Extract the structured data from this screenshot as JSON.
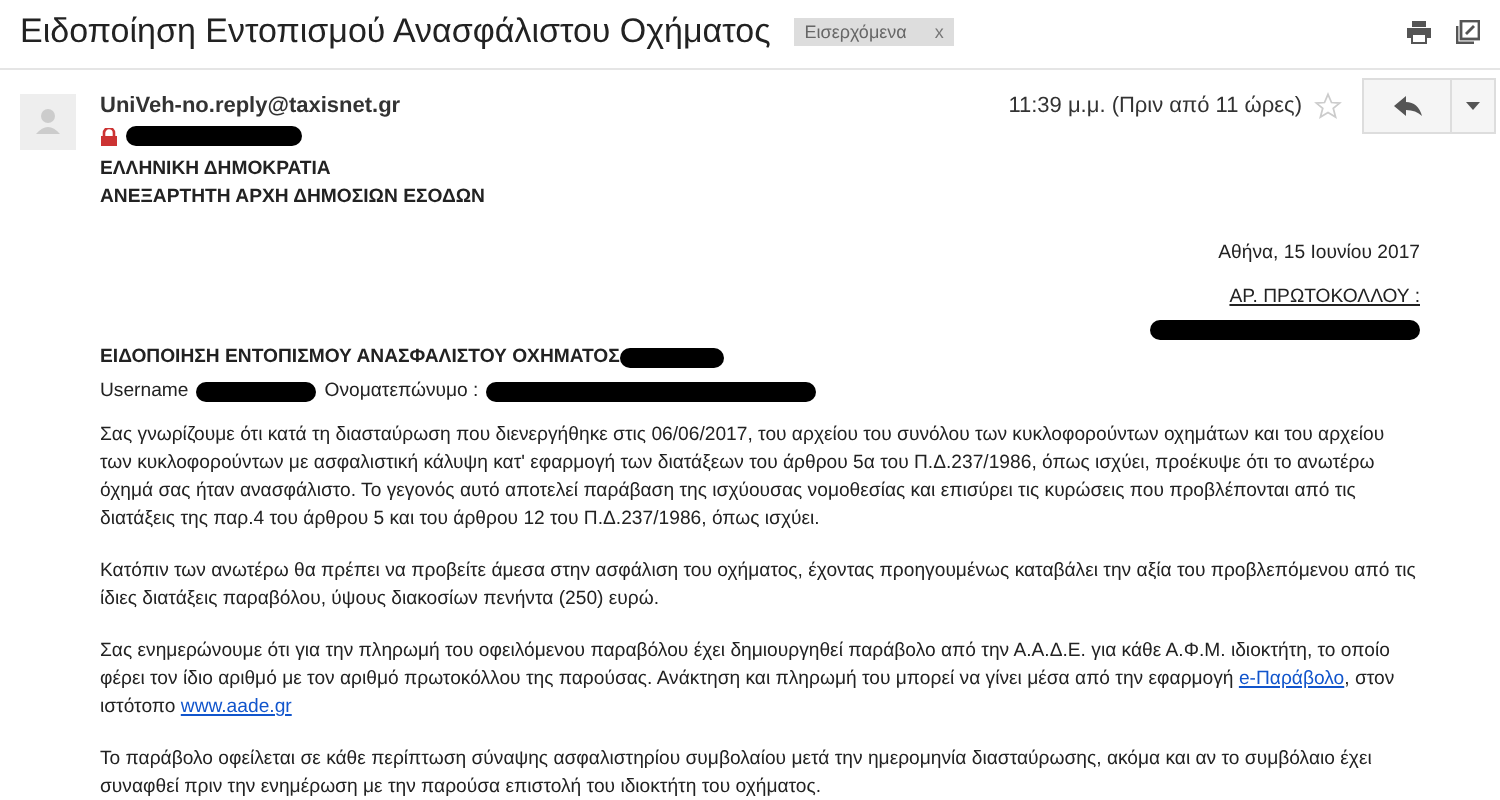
{
  "subject": "Ειδοποίηση Εντοπισμού Ανασφάλιστου Οχήματος",
  "label_chip": {
    "label": "Εισερχόμενα",
    "remove": "x"
  },
  "sender": "UniVeh-no.reply@taxisnet.gr",
  "time": "11:39 μ.μ. (Πριν από 11 ώρες)",
  "starred": false,
  "header_lines": [
    "ΕΛΛΗΝΙΚΗ ΔΗΜΟΚΡΑΤΙΑ",
    "ΑΝΕΞΑΡΤΗΤΗ ΑΡΧΗ ΔΗΜΟΣΙΩΝ ΕΣΟΔΩΝ"
  ],
  "date_line": "Αθήνα, 15 Ιουνίου 2017",
  "protocol_label": "ΑΡ. ΠΡΩΤΟΚΟΛΛΟΥ :",
  "notice_title": "ΕΙΔΟΠΟΙΗΣΗ ΕΝΤΟΠΙΣΜΟΥ ΑΝΑΣΦΑΛΙΣΤΟΥ ΟΧΗΜΑΤΟΣ",
  "username_label": "Username",
  "fullname_label": "Ονοματεπώνυμο :",
  "paragraphs": [
    [
      {
        "kind": "text",
        "text": "Σας γνωρίζουμε ότι κατά τη διασταύρωση που διενεργήθηκε στις 06/06/2017, του αρχείου του συνόλου των κυκλοφορούντων οχημάτων και του αρχείου των κυκλοφορούντων με ασφαλιστική κάλυψη κατ' εφαρμογή των διατάξεων του άρθρου 5α του Π.Δ.237/1986, όπως ισχύει, προέκυψε ότι το ανωτέρω όχημά σας ήταν ανασφάλιστο. Το γεγονός αυτό αποτελεί παράβαση της ισχύουσας νομοθεσίας και επισύρει τις κυρώσεις που προβλέπονται από τις διατάξεις της παρ.4 του άρθρου 5 και του άρθρου 12 του Π.Δ.237/1986, όπως ισχύει."
      }
    ],
    [
      {
        "kind": "text",
        "text": "Κατόπιν των ανωτέρω θα πρέπει να προβείτε άμεσα στην ασφάλιση του οχήματος, έχοντας προηγουμένως καταβάλει την αξία του προβλεπόμενου από τις ίδιες διατάξεις παραβόλου, ύψους διακοσίων πενήντα (250) ευρώ."
      }
    ],
    [
      {
        "kind": "text",
        "text": "Σας ενημερώνουμε ότι για την πληρωμή του οφειλόμενου παραβόλου έχει δημιουργηθεί παράβολο από την Α.Α.Δ.Ε. για κάθε Α.Φ.Μ. ιδιοκτήτη, το οποίο φέρει τον ίδιο αριθμό με τον αριθμό πρωτοκόλλου της παρούσας. Ανάκτηση και πληρωμή του μπορεί να γίνει μέσα από την εφαρμογή "
      },
      {
        "kind": "link",
        "text": "e-Παράβολο"
      },
      {
        "kind": "text",
        "text": ", στον ιστότοπο "
      },
      {
        "kind": "link",
        "text": "www.aade.gr"
      }
    ],
    [
      {
        "kind": "text",
        "text": "Το παράβολο οφείλεται σε κάθε περίπτωση σύναψης ασφαλιστηρίου συμβολαίου μετά την ημερομηνία διασταύρωσης, ακόμα και αν το συμβόλαιο έχει συναφθεί πριν την ενημέρωση με την παρούσα επιστολή του ιδιοκτήτη του οχήματος."
      }
    ]
  ]
}
